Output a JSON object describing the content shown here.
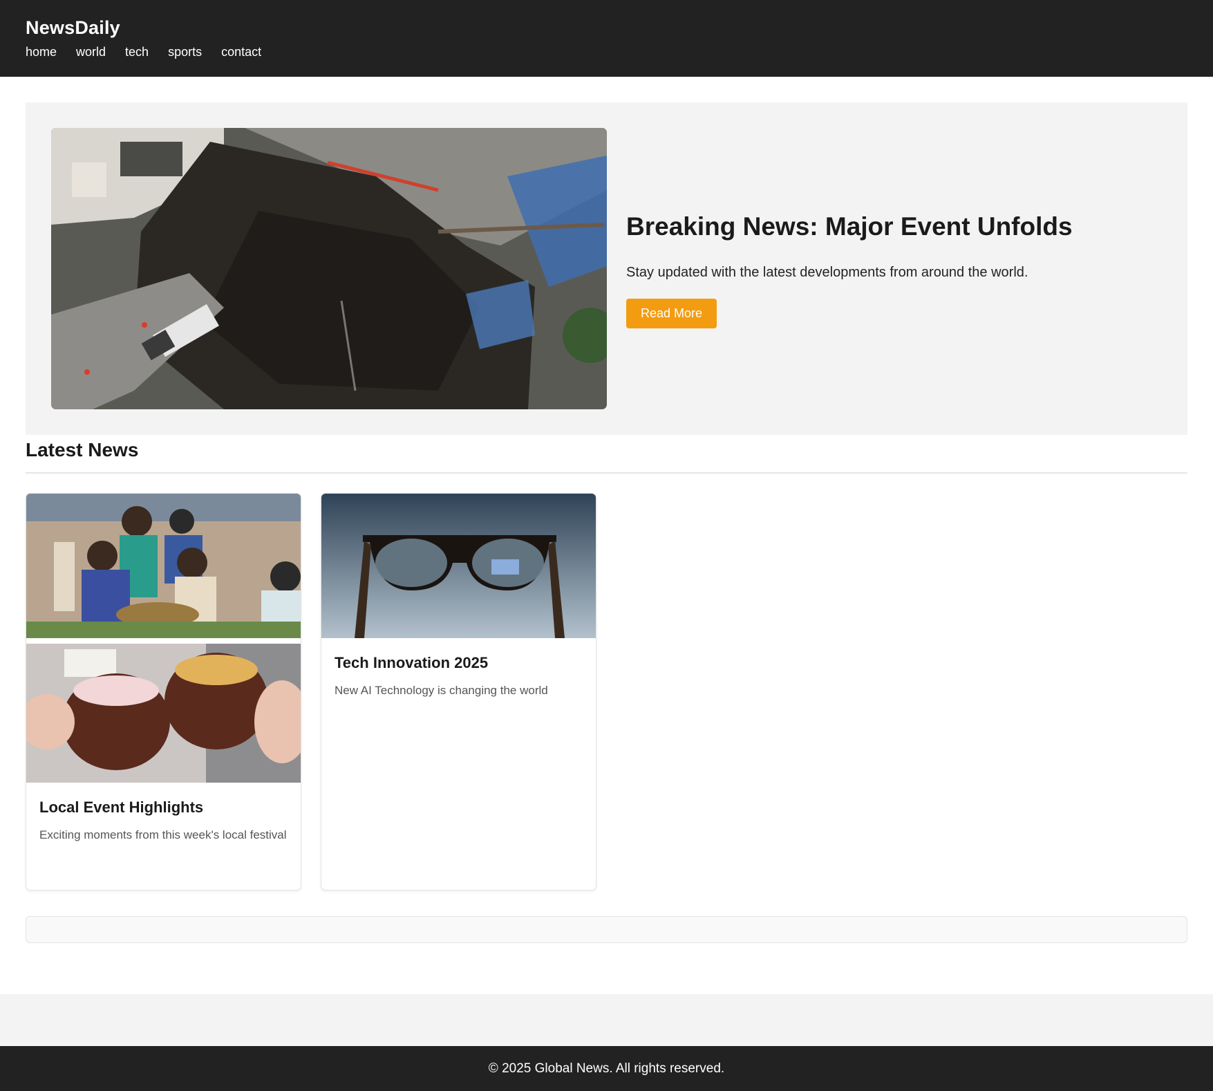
{
  "header": {
    "brand": "NewsDaily",
    "nav": [
      "home",
      "world",
      "tech",
      "sports",
      "contact"
    ]
  },
  "hero": {
    "title": "Breaking News: Major Event Unfolds",
    "description": "Stay updated with the latest developments from around the world.",
    "button_label": "Read More",
    "image_alt": "aerial photo of a collapsed road sinkhole"
  },
  "latest": {
    "heading": "Latest News",
    "cards": [
      {
        "title": "Local Event Highlights",
        "description": "Exciting moments from this week's local festival",
        "image_alt": "festival crowd and coconut desserts"
      },
      {
        "title": "Tech Innovation 2025",
        "description": "New AI Technology is changing the world",
        "image_alt": "smart glasses with display"
      }
    ]
  },
  "footer": {
    "text": "© 2025 Global News. All rights reserved."
  },
  "colors": {
    "header_bg": "#222222",
    "accent": "#f39c12",
    "hero_bg": "#f3f3f3"
  }
}
